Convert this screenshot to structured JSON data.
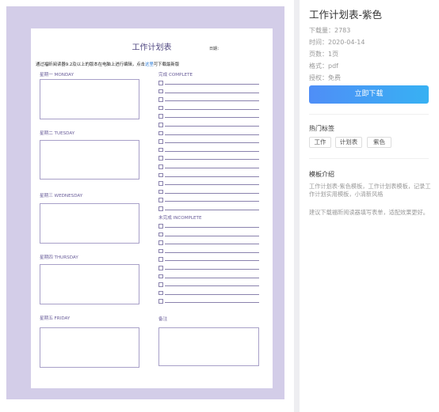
{
  "doc": {
    "title": "工作计划表",
    "date_label": "日期：",
    "notice_before": "通过福昕阅读器9.2及以上的版本在电脑上进行编辑，点击",
    "notice_link": "这里",
    "notice_after": "可下载最新版",
    "days": [
      "星期一 MONDAY",
      "星期二 TUESDAY",
      "星期三 WEDNESDAY",
      "星期四 THURSDAY",
      "星期五 FRIDAY"
    ],
    "complete_label": "完成 COMPLETE",
    "incomplete_label": "未完成 INCOMPLETE",
    "notes_label": "备注"
  },
  "sidebar": {
    "title": "工作计划表-紫色",
    "downloads": "下载量：2783",
    "time": "时间：2020-04-14",
    "pages": "页数：1页",
    "format": "格式：pdf",
    "license": "授权：免费",
    "download_button": "立即下载",
    "hot_tags_title": "热门标签",
    "tags": [
      "工作",
      "计划表",
      "紫色"
    ],
    "intro_title": "模板介绍",
    "intro_text": "工作计划表-紫色模板，工作计划表模板，记录工作计划实用模板，小清新风格",
    "suggestion": "建议下载福昕阅读器填写表单，适配效果更好。"
  },
  "colors": {
    "accent_start": "#4f8ef7",
    "accent_end": "#37b1f3",
    "frame": "#d3cde8",
    "doc_text": "#5a4f86"
  }
}
